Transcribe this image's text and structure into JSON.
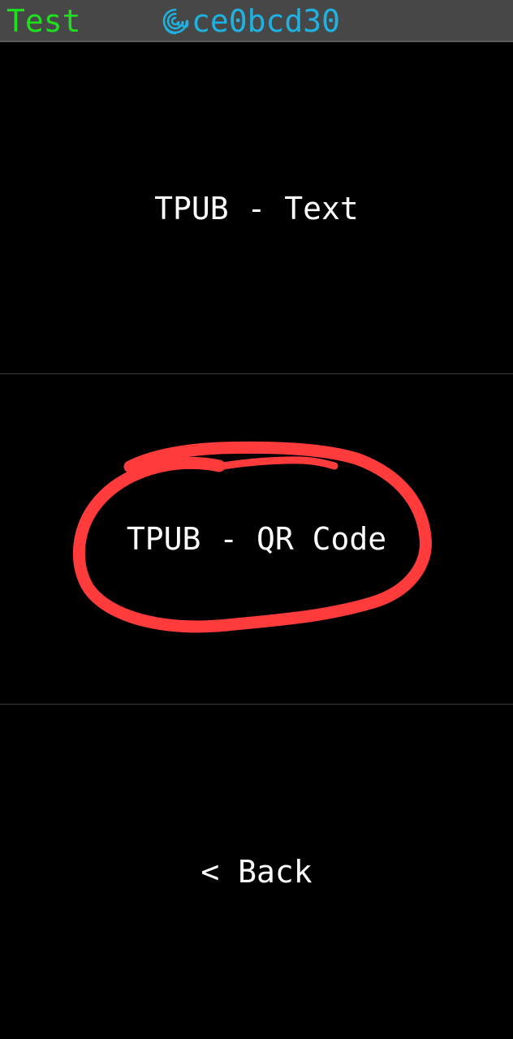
{
  "status_bar": {
    "wallet_name": "Test",
    "fingerprint": "ce0bcd30",
    "fingerprint_icon": "fingerprint-icon",
    "wallet_name_color": "#1fe01f",
    "fingerprint_color": "#1fb2e0"
  },
  "menu": {
    "items": [
      {
        "label": "TPUB - Text"
      },
      {
        "label": "TPUB - QR Code"
      },
      {
        "label": "< Back"
      }
    ]
  },
  "annotation": {
    "shape": "freehand-circle",
    "color": "#ff3b3b",
    "target": "TPUB - QR Code"
  }
}
